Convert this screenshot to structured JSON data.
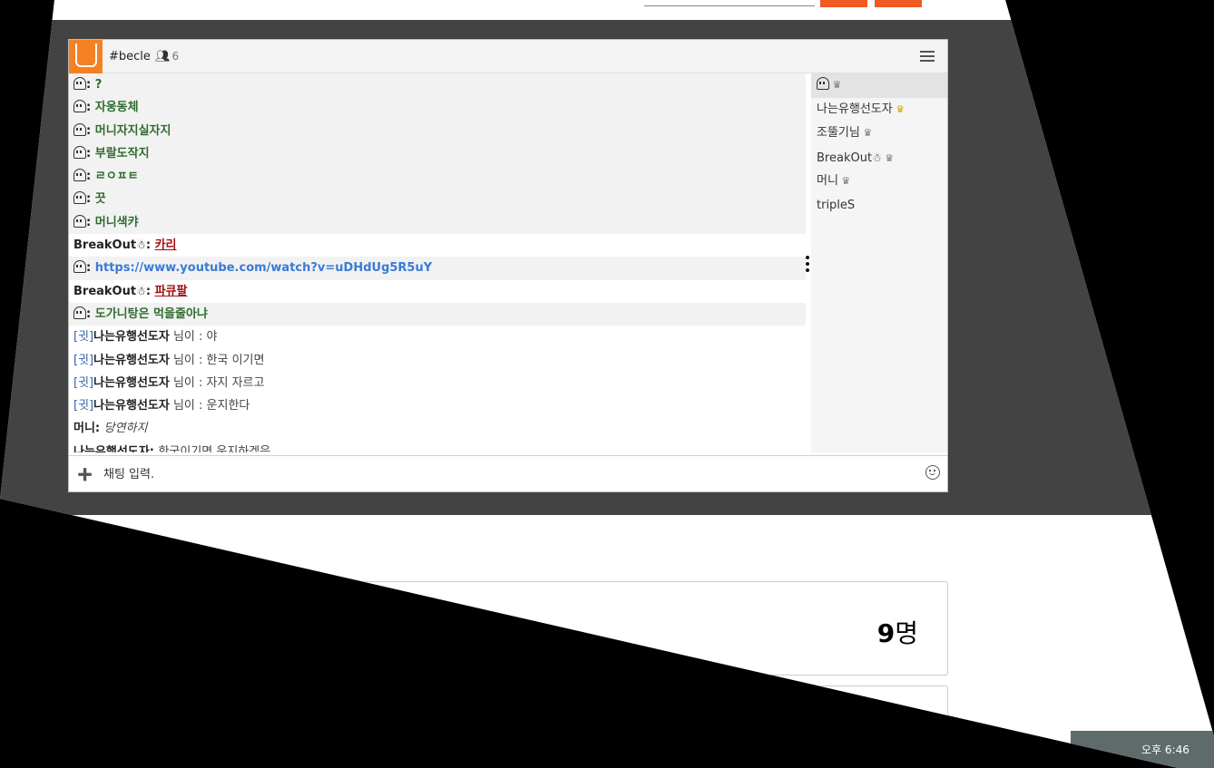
{
  "chat": {
    "channel": "#becle",
    "user_count": "6",
    "messages": [
      {
        "nick": "",
        "ghost": true,
        "text": "?",
        "style": "green",
        "highlight": true
      },
      {
        "nick": "",
        "ghost": true,
        "text": "자웅동체",
        "style": "green",
        "highlight": true
      },
      {
        "nick": "",
        "ghost": true,
        "text": "머니자지실자지",
        "style": "green",
        "highlight": true
      },
      {
        "nick": "",
        "ghost": true,
        "text": "부랄도작지",
        "style": "green",
        "highlight": true
      },
      {
        "nick": "",
        "ghost": true,
        "text": "ㄹㅇㅍㅌ",
        "style": "green",
        "highlight": true
      },
      {
        "nick": "",
        "ghost": true,
        "text": "끗",
        "style": "green",
        "highlight": true
      },
      {
        "nick": "",
        "ghost": true,
        "text": "머니색캬",
        "style": "green",
        "highlight": true
      },
      {
        "nick": "BreakOut",
        "snow": true,
        "text": "카리",
        "style": "red",
        "highlight": false
      },
      {
        "nick": "",
        "ghost": true,
        "text": "https://www.youtube.com/watch?v=uDHdUg5R5uY",
        "style": "link",
        "highlight": true
      },
      {
        "nick": "BreakOut",
        "snow": true,
        "text": "파큐팔",
        "style": "red",
        "highlight": false
      },
      {
        "nick": "",
        "ghost": true,
        "text": "도가니탕은 먹을줄아냐",
        "style": "green",
        "highlight": true
      },
      {
        "tag": "[귓]",
        "nick": "나는유행선도자",
        "suffix": " 님이 : ",
        "text": "야",
        "style": "sys",
        "highlight": false
      },
      {
        "tag": "[귓]",
        "nick": "나는유행선도자",
        "suffix": " 님이 : ",
        "text": "한국 이기면",
        "style": "sys",
        "highlight": false
      },
      {
        "tag": "[귓]",
        "nick": "나는유행선도자",
        "suffix": " 님이 : ",
        "text": "자지 자르고",
        "style": "sys",
        "highlight": false
      },
      {
        "tag": "[귓]",
        "nick": "나는유행선도자",
        "suffix": " 님이 : ",
        "text": "운지한다",
        "style": "sys",
        "highlight": false
      },
      {
        "nick": "머니",
        "text": "당연하지",
        "style": "italic",
        "highlight": false
      },
      {
        "nick": "나는유행선도자",
        "text": "한국이기면 운지하겠음",
        "style": "plain",
        "highlight": false
      }
    ],
    "users": [
      {
        "name": "",
        "ghost": true,
        "crown": "gray",
        "selected": true
      },
      {
        "name": "나는유행선도자",
        "crown": "gold"
      },
      {
        "name": "조뚤기님",
        "crown": "gray"
      },
      {
        "name": "BreakOut",
        "snow": true,
        "crown": "gray"
      },
      {
        "name": "머니",
        "crown": "gray"
      },
      {
        "name": "tripleS",
        "crown": ""
      }
    ],
    "input_value": "채팅 입력."
  },
  "card": {
    "count_number": "9",
    "count_unit": "명"
  },
  "taskbar": {
    "time": "오후 6:46"
  },
  "colors": {
    "accent": "#f48024",
    "dark_band": "#434343",
    "link": "#3a7bd5",
    "green_text": "#2f6b2f",
    "red_text": "#a01010"
  }
}
